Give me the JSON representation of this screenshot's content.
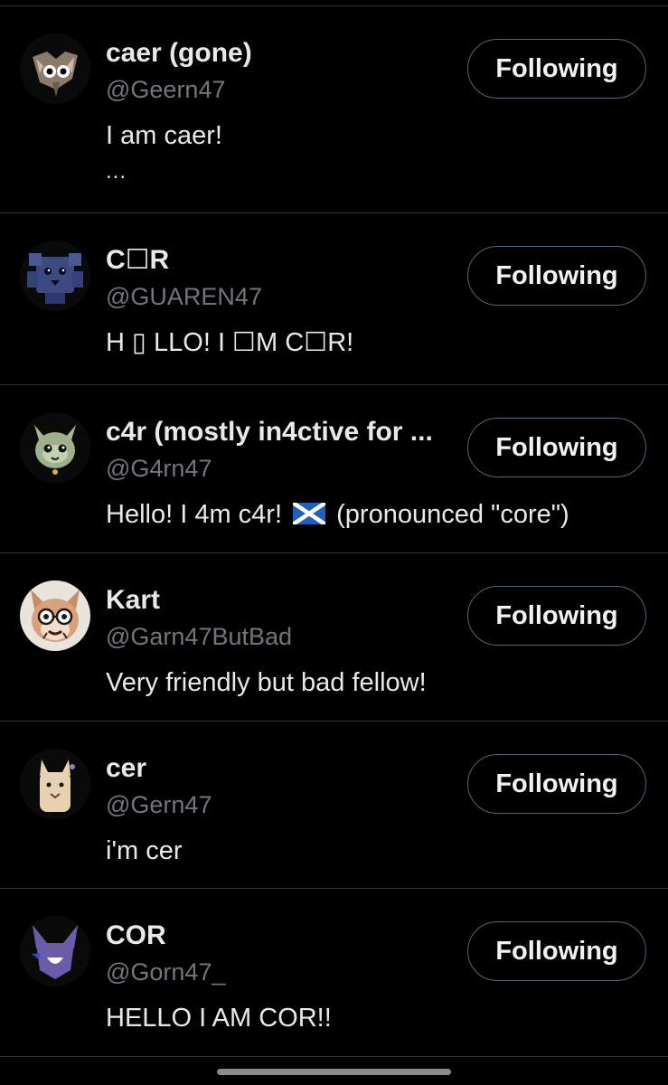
{
  "follow_list": [
    {
      "display_name": "caer (gone)",
      "handle": "@Geern47",
      "bio": "I am caer!",
      "bio_more": "...",
      "button_label": "Following",
      "avatar_icon": "cat-character-avatar"
    },
    {
      "display_name": "C☐R",
      "handle": "@GUAREN47",
      "bio": "H ▯ LLO! I ☐M C☐R!",
      "button_label": "Following",
      "avatar_icon": "blue-cube-character-avatar"
    },
    {
      "display_name": "c4r (mostly in4ctive for ...",
      "handle": "@G4rn47",
      "bio_before_flag": "Hello! I 4m c4r! ",
      "bio_flag_icon": "scotland-flag-icon",
      "bio_after_flag": " (pronounced \"core\")",
      "button_label": "Following",
      "avatar_icon": "green-cat-character-avatar"
    },
    {
      "display_name": "Kart",
      "handle": "@Garn47ButBad",
      "bio": "Very friendly but bad fellow!",
      "button_label": "Following",
      "avatar_icon": "fox-with-glasses-avatar"
    },
    {
      "display_name": "cer",
      "handle": "@Gern47",
      "bio": "i'm cer",
      "button_label": "Following",
      "avatar_icon": "beige-cat-character-avatar"
    },
    {
      "display_name": "COR",
      "handle": "@Gorn47_",
      "bio": "HELLO I AM COR!!",
      "button_label": "Following",
      "avatar_icon": "purple-cat-character-avatar"
    }
  ],
  "colors": {
    "background": "#000000",
    "primary_text": "#e7e9ea",
    "secondary_text": "#71767b",
    "divider": "#2f3336",
    "button_border": "#536471"
  }
}
